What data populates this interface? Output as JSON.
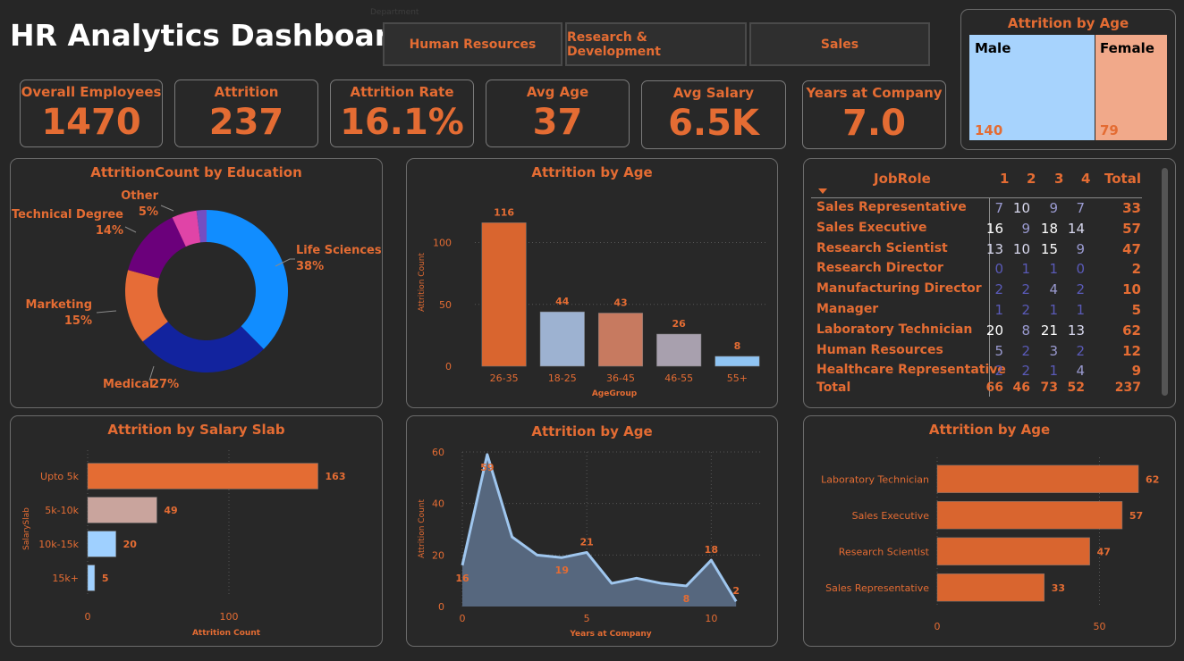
{
  "header": {
    "title": "HR Analytics Dashboard"
  },
  "slicer": {
    "label": "Department",
    "options": [
      "Human Resources",
      "Research & Development",
      "Sales"
    ]
  },
  "kpis": [
    {
      "label": "Overall Employees",
      "value": "1470"
    },
    {
      "label": "Attrition",
      "value": "237"
    },
    {
      "label": "Attrition Rate",
      "value": "16.1%"
    },
    {
      "label": "Avg Age",
      "value": "37"
    },
    {
      "label": "Avg Salary",
      "value": "6.5K"
    },
    {
      "label": "Years at Company",
      "value": "7.0"
    }
  ],
  "gender_card": {
    "title": "Attrition by Age",
    "male_label": "Male",
    "male_value": "140",
    "female_label": "Female",
    "female_value": "79"
  },
  "colors": {
    "accent": "#e46c33",
    "background": "#262626",
    "panel_border": "#6b6b6b"
  },
  "chart_data": [
    {
      "id": "education",
      "type": "pie",
      "title": "AttritionCount by Education",
      "slices": [
        {
          "label": "Life Sciences",
          "pct_label": "38%",
          "value": 38,
          "color": "#118dff"
        },
        {
          "label": "Medical",
          "pct_label": "27%",
          "value": 27,
          "color": "#12239e"
        },
        {
          "label": "Marketing",
          "pct_label": "15%",
          "value": 15,
          "color": "#e66c37"
        },
        {
          "label": "Technical Degree",
          "pct_label": "14%",
          "value": 14,
          "color": "#6b007b"
        },
        {
          "label": "Other",
          "pct_label": "5%",
          "value": 5,
          "color": "#e044a7"
        },
        {
          "label": "",
          "pct_label": "",
          "value": 2,
          "color": "#744ec2"
        }
      ]
    },
    {
      "id": "age",
      "type": "bar",
      "title": "Attrition by Age",
      "xlabel": "AgeGroup",
      "ylabel": "Attrition Count",
      "categories": [
        "26-35",
        "18-25",
        "36-45",
        "46-55",
        "55+"
      ],
      "values": [
        116,
        44,
        43,
        26,
        8
      ],
      "colors": [
        "#d9652f",
        "#9db2d1",
        "#c77a60",
        "#a8a0ae",
        "#8fc4f3"
      ],
      "ylim": [
        0,
        130
      ],
      "yticks": [
        0,
        50,
        100
      ],
      "grid": true
    },
    {
      "id": "salary",
      "type": "bar",
      "orientation": "horizontal",
      "title": "Attrition by Salary Slab",
      "xlabel": "Attrition Count",
      "ylabel": "SalarySlab",
      "categories": [
        "Upto 5k",
        "5k-10k",
        "10k-15k",
        "15k+"
      ],
      "values": [
        163,
        49,
        20,
        5
      ],
      "colors": [
        "#e46c33",
        "#c9a49d",
        "#9fd0ff",
        "#9fd0ff"
      ],
      "xlim": [
        0,
        200
      ],
      "xticks": [
        0,
        100
      ],
      "grid": true
    },
    {
      "id": "years",
      "type": "area",
      "title": "Attrition by Age",
      "xlabel": "Years at Company",
      "ylabel": "Attrition Count",
      "x": [
        0,
        1,
        2,
        3,
        4,
        5,
        6,
        7,
        8,
        9,
        10,
        11
      ],
      "y": [
        16,
        59,
        27,
        20,
        19,
        21,
        9,
        11,
        9,
        8,
        18,
        2
      ],
      "point_labels": [
        {
          "x": 0,
          "text": "16"
        },
        {
          "x": 1,
          "text": "59"
        },
        {
          "x": 4,
          "text": "19"
        },
        {
          "x": 5,
          "text": "21"
        },
        {
          "x": 9,
          "text": "8"
        },
        {
          "x": 10,
          "text": "18"
        },
        {
          "x": 11,
          "text": "2"
        }
      ],
      "xlim": [
        0,
        12
      ],
      "ylim": [
        0,
        60
      ],
      "xticks": [
        0,
        5,
        10
      ],
      "yticks": [
        0,
        20,
        40,
        60
      ],
      "grid": true
    },
    {
      "id": "jobrole",
      "type": "bar",
      "orientation": "horizontal",
      "title": "Attrition by Age",
      "categories": [
        "Laboratory Technician",
        "Sales Executive",
        "Research Scientist",
        "Sales Representative"
      ],
      "values": [
        62,
        57,
        47,
        33
      ],
      "color": "#d9652f",
      "xlim": [
        0,
        62
      ],
      "xticks": [
        0,
        50
      ],
      "grid": true
    }
  ],
  "matrix": {
    "headers": [
      "JobRole",
      "1",
      "2",
      "3",
      "4",
      "Total"
    ],
    "rows": [
      {
        "role": "Sales Representative",
        "v": [
          "7",
          "10",
          "9",
          "7"
        ],
        "total": "33"
      },
      {
        "role": "Sales Executive",
        "v": [
          "16",
          "9",
          "18",
          "14"
        ],
        "total": "57"
      },
      {
        "role": "Research Scientist",
        "v": [
          "13",
          "10",
          "15",
          "9"
        ],
        "total": "47"
      },
      {
        "role": "Research Director",
        "v": [
          "0",
          "1",
          "1",
          "0"
        ],
        "total": "2"
      },
      {
        "role": "Manufacturing Director",
        "v": [
          "2",
          "2",
          "4",
          "2"
        ],
        "total": "10"
      },
      {
        "role": "Manager",
        "v": [
          "1",
          "2",
          "1",
          "1"
        ],
        "total": "5"
      },
      {
        "role": "Laboratory Technician",
        "v": [
          "20",
          "8",
          "21",
          "13"
        ],
        "total": "62"
      },
      {
        "role": "Human Resources",
        "v": [
          "5",
          "2",
          "3",
          "2"
        ],
        "total": "12"
      },
      {
        "role": "Healthcare Representative",
        "v": [
          "2",
          "2",
          "1",
          "4"
        ],
        "total": "9"
      }
    ],
    "total_row": {
      "label": "Total",
      "v": [
        "66",
        "46",
        "73",
        "52"
      ],
      "total": "237"
    }
  }
}
